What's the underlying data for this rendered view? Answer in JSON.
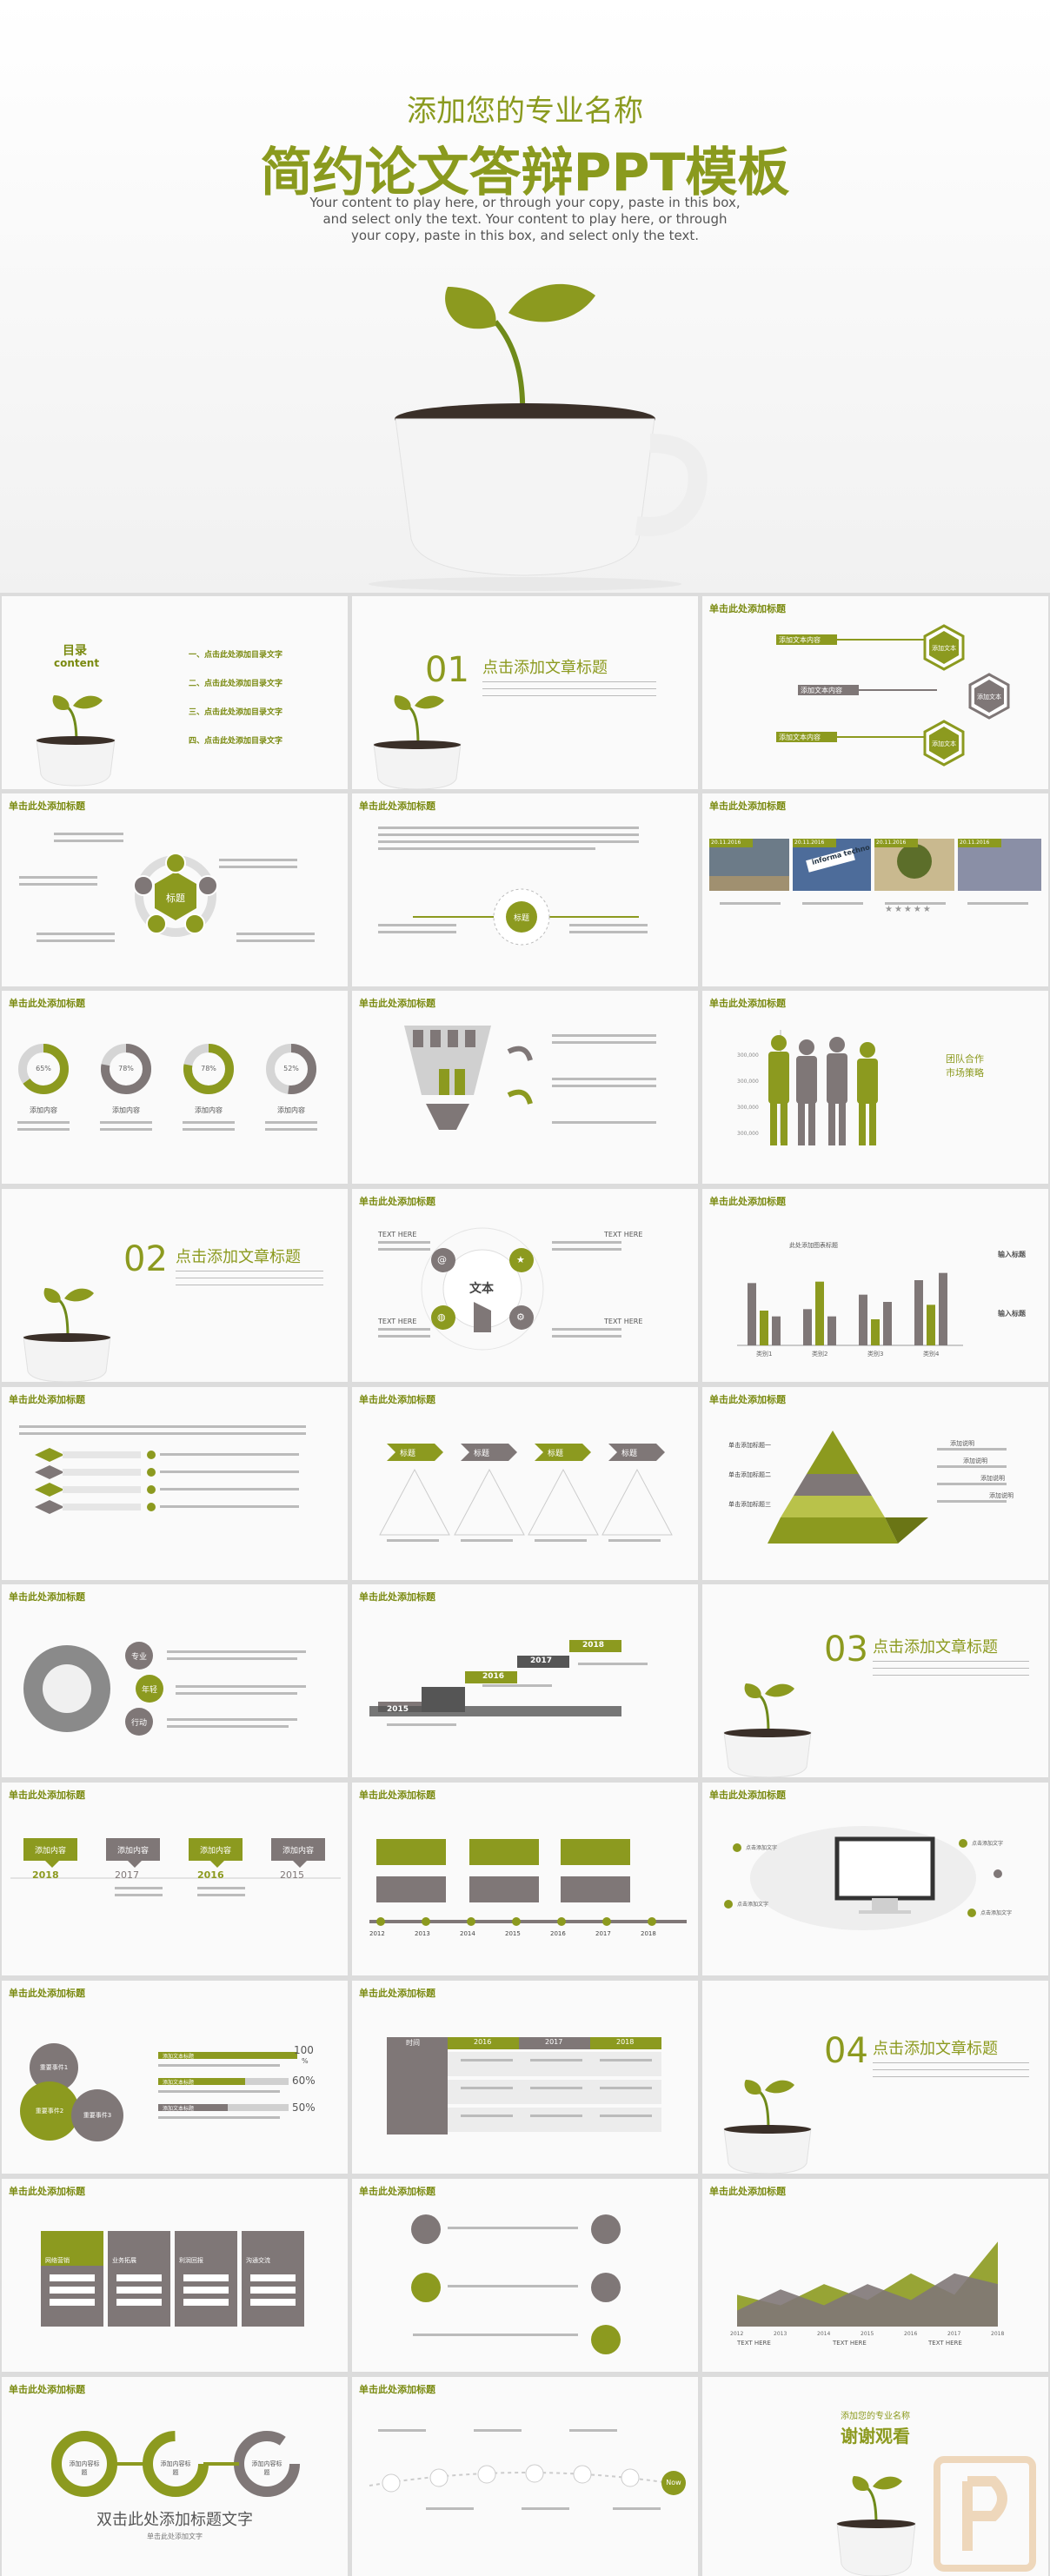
{
  "hero": {
    "subtitle": "添加您的专业名称",
    "title": "简约论文答辩PPT模板",
    "body": "Your content to play here, or through your copy, paste in this box, and select only the text. Your content to play here, or through your copy, paste in this box, and select only the text."
  },
  "common": {
    "slide_title": "单击此处添加标题"
  },
  "toc": {
    "title": "目录",
    "subtitle": "content",
    "items": [
      "一、点击此处添加目录文字",
      "二、点击此处添加目录文字",
      "三、点击此处添加目录文字",
      "四、点击此处添加目录文字"
    ]
  },
  "sections": [
    {
      "num": "01",
      "title": "点击添加文章标题"
    },
    {
      "num": "02",
      "title": "点击添加文章标题"
    },
    {
      "num": "03",
      "title": "点击添加文章标题"
    },
    {
      "num": "04",
      "title": "点击添加文章标题"
    }
  ],
  "hex": {
    "labels": [
      "添加文本内容",
      "添加文本内容",
      "添加文本内容"
    ],
    "hex_text": [
      "添加文本",
      "添加文本",
      "添加文本"
    ]
  },
  "photos": {
    "dates": [
      "20.11.2016",
      "20.11.2016",
      "20.11.2016",
      "20.11.2016"
    ],
    "sign": "informa techno"
  },
  "donuts": {
    "values": [
      "65%",
      "78%",
      "78%",
      "52%"
    ],
    "fractions": [
      0.65,
      0.78,
      0.78,
      0.52
    ],
    "label": "添加内容"
  },
  "team": {
    "title1": "团队合作",
    "title2": "市场策略",
    "axis": [
      "300,000",
      "300,000",
      "300,000",
      "300,000"
    ]
  },
  "text_slide": {
    "text_here": "TEXT HERE",
    "center": "文本"
  },
  "bars": {
    "title": "此处添加图表标题",
    "heading": "输入标题",
    "categories": [
      "类别1",
      "类别2",
      "类别3",
      "类别4"
    ],
    "series": [
      {
        "values": [
          4.3,
          2.5,
          3.5,
          4.5
        ]
      },
      {
        "values": [
          2.4,
          4.4,
          1.8,
          2.8
        ]
      },
      {
        "values": [
          2.0,
          2.0,
          3.0,
          5.0
        ]
      }
    ]
  },
  "arrows": {
    "labels": [
      "标题",
      "标题",
      "标题",
      "标题"
    ]
  },
  "pyramid": {
    "labels": [
      "单击添加标题一",
      "单击添加标题二",
      "单击添加标题三"
    ],
    "side": [
      "添加说明",
      "添加说明",
      "添加说明",
      "添加说明"
    ]
  },
  "circles": {
    "labels": [
      "专业",
      "年轻",
      "行动"
    ]
  },
  "steps": {
    "years": [
      "2015",
      "2016",
      "2017",
      "2018"
    ]
  },
  "bubbles": {
    "label": "添加内容",
    "years": [
      "2018",
      "2017",
      "2016",
      "2015"
    ]
  },
  "timeline": {
    "years": [
      "2012",
      "2013",
      "2014",
      "2015",
      "2016",
      "2017",
      "2018"
    ]
  },
  "monitor": {
    "label": "点击添加文字"
  },
  "progress": {
    "events": [
      "重要事件1",
      "重要事件2",
      "重要事件3"
    ],
    "percents": [
      "100",
      "60%",
      "50%"
    ],
    "percent_sign": "%",
    "bar_label": "添加文本标题"
  },
  "table": {
    "headers": [
      "时间",
      "2016",
      "2017",
      "2018"
    ]
  },
  "icons_slide": {
    "labels": [
      "网络营销",
      "业务拓展",
      "利润回报",
      "沟通交流"
    ],
    "row_label": "点击添加文字"
  },
  "ring_slide": {
    "title": "双击此处添加标题文字",
    "texts": [
      "添加内容标题",
      "添加内容标题",
      "添加内容标题"
    ],
    "sub": "单击此处添加文字"
  },
  "roadmap": {
    "end": "Now"
  },
  "area_chart": {
    "x": [
      "2012",
      "2013",
      "2014",
      "2015",
      "2016",
      "2017",
      "2018"
    ],
    "series": [
      {
        "values": [
          3,
          2,
          4,
          2.5,
          5,
          3,
          8
        ]
      },
      {
        "values": [
          1.5,
          3.5,
          2,
          4,
          2.5,
          5,
          4
        ]
      }
    ],
    "text_here": "TEXT HERE"
  },
  "end": {
    "subtitle": "添加您的专业名称",
    "title": "谢谢观看"
  },
  "colors": {
    "accent": "#8c9a1f",
    "gray": "#7f7777",
    "bg": "#fafafa"
  }
}
